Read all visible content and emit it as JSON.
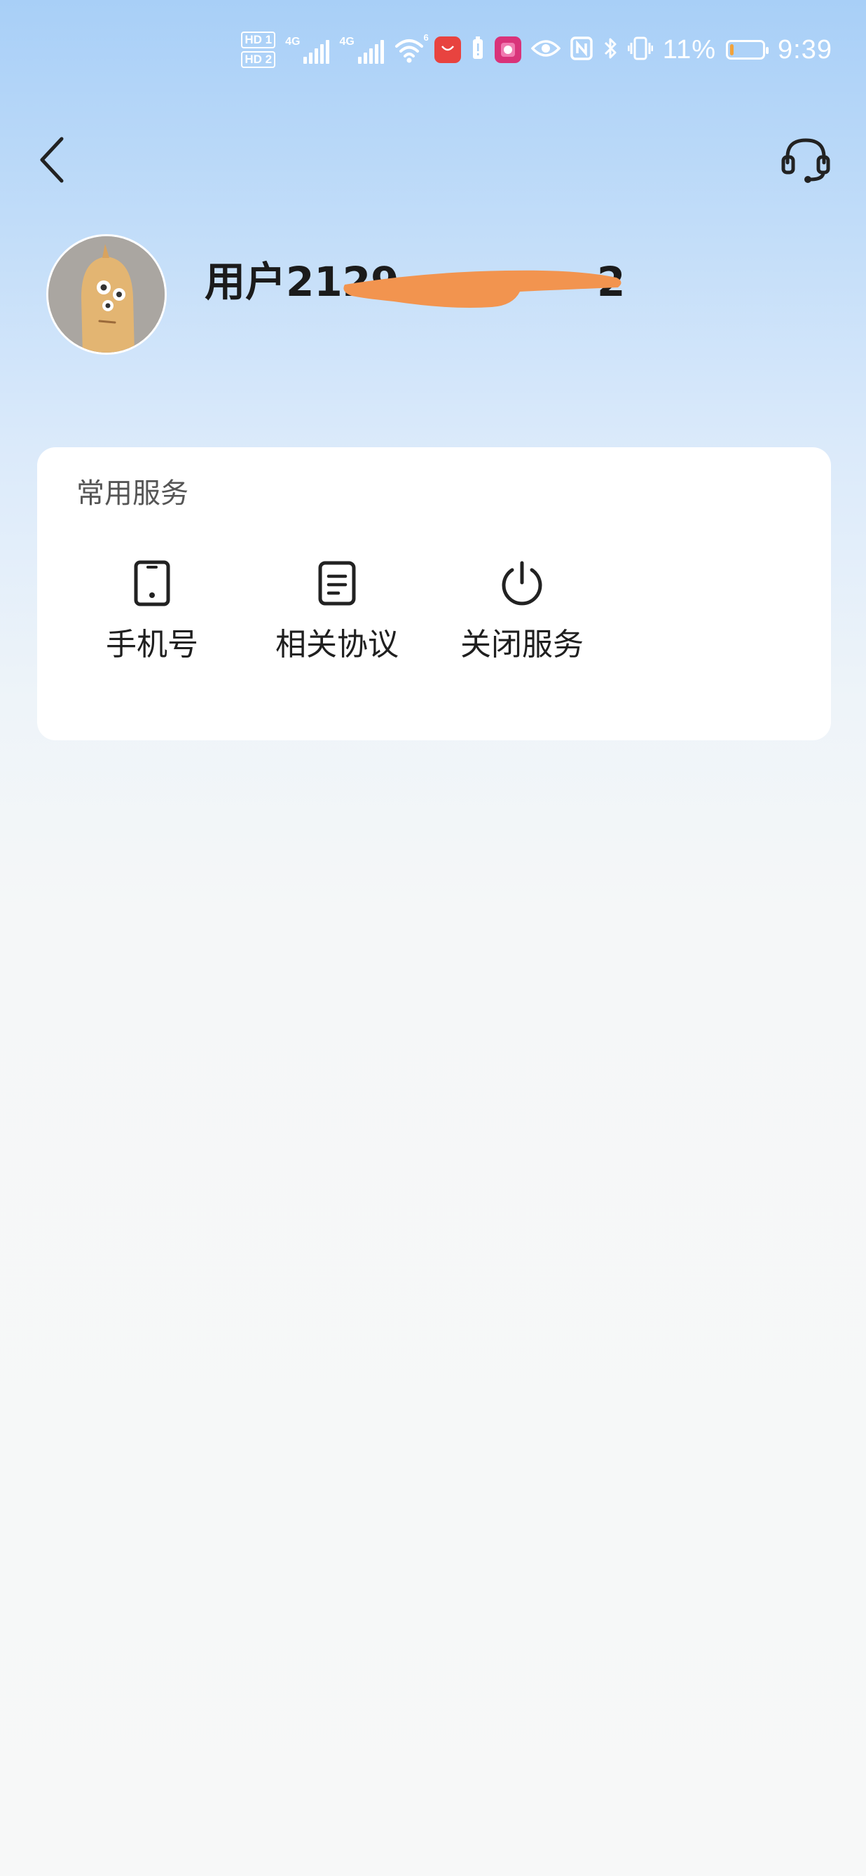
{
  "status_bar": {
    "hd1": "HD",
    "hd1_sim": "1",
    "hd2": "HD",
    "hd2_sim": "2",
    "net1": "4G",
    "net2": "4G",
    "wifi": "6",
    "battery_percent": "11%",
    "battery_level": 0.11,
    "time": "9:39",
    "icons": [
      "wifi-icon",
      "app-store-icon",
      "battery-saver-icon",
      "mall-app-icon",
      "eye-comfort-icon",
      "nfc-icon",
      "bluetooth-icon",
      "vibrate-icon"
    ]
  },
  "nav": {
    "back_icon": "chevron-left-icon",
    "support_icon": "headset-icon"
  },
  "profile": {
    "username": "用户2129",
    "username_suffix": "2"
  },
  "services_card": {
    "title": "常用服务",
    "items": [
      {
        "label": "手机号",
        "icon": "mobile-phone-icon"
      },
      {
        "label": "相关协议",
        "icon": "document-icon"
      },
      {
        "label": "关闭服务",
        "icon": "power-icon"
      }
    ]
  },
  "colors": {
    "redaction": "#f2944f",
    "battery_fill": "#f2a23a"
  }
}
